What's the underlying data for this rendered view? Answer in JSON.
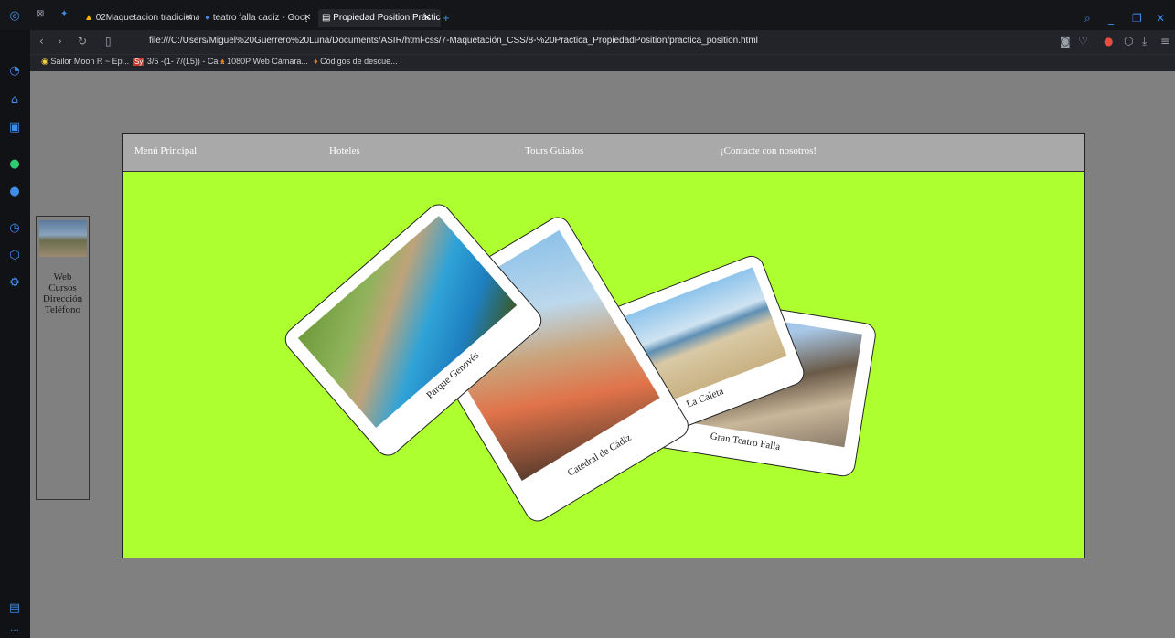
{
  "browser": {
    "tabs": [
      {
        "title": "02Maquetacion tradicional"
      },
      {
        "title": "teatro falla cadiz - Google"
      },
      {
        "title": "Propiedad Position Práctica"
      }
    ],
    "address": "file:///C:/Users/Miguel%20Guerrero%20Luna/Documents/ASIR/html-css/7-Maquetación_CSS/8-%20Practica_PropiedadPosition/practica_position.html",
    "bookmarks": [
      {
        "label": "Sailor Moon R ~ Ep..."
      },
      {
        "label": "3/5 -(1- 7/(15)) - Ca..."
      },
      {
        "label": "1080P Web Cámara..."
      },
      {
        "label": "Códigos de descue..."
      }
    ]
  },
  "menu": {
    "items": [
      {
        "label": "Menú Principal"
      },
      {
        "label": "Hoteles"
      },
      {
        "label": "Tours Guiados"
      },
      {
        "label": "¡Contacte con nosotros!"
      }
    ]
  },
  "aside": {
    "lines": [
      "Web",
      "Cursos",
      "Dirección",
      "Teléfono"
    ]
  },
  "cards": [
    {
      "caption": "Gran Teatro Falla"
    },
    {
      "caption": "La Caleta"
    },
    {
      "caption": "Catedral de Cádiz"
    },
    {
      "caption": "Parque Genovés"
    }
  ],
  "colors": {
    "main_bg": "#adff2f",
    "menu_bg": "#a9a9a9",
    "page_bg": "#808080",
    "accent": "#3e8ee8"
  }
}
